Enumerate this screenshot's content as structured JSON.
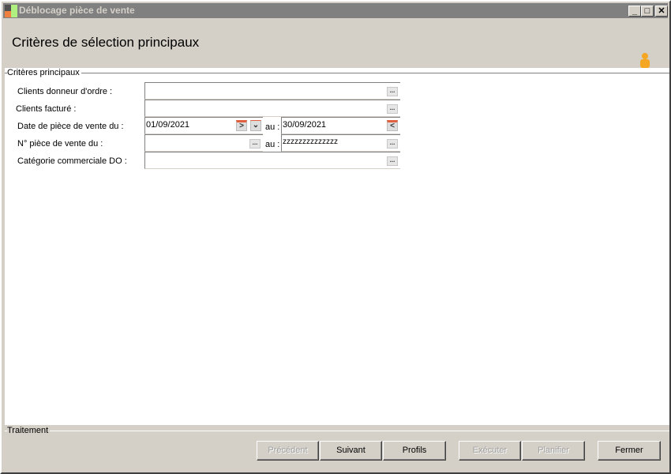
{
  "window": {
    "title": "Déblocage pièce de vente",
    "controls": [
      "minimize",
      "maximize",
      "close"
    ]
  },
  "header": {
    "title": "Critères de sélection principaux",
    "icon": "user-icon"
  },
  "criteria": {
    "group_label": "Critères principaux",
    "fields": [
      {
        "label": "Clients donneur d'ordre :",
        "value": ""
      },
      {
        "label": "Clients facturé :",
        "value": ""
      },
      {
        "label": "Date de pièce de vente du :",
        "value_from": "01/09/2021",
        "to_label": "au :",
        "value_to": "30/09/2021"
      },
      {
        "label": "N° pièce de vente du :",
        "value_from": "",
        "to_label": "au :",
        "value_to": "zzzzzzzzzzzzzz"
      },
      {
        "label": "Catégorie commerciale DO :",
        "value": ""
      }
    ]
  },
  "footer": {
    "group_label": "Traitement",
    "buttons": [
      {
        "label": "Précédent",
        "enabled": false
      },
      {
        "label": "Suivant",
        "enabled": true
      },
      {
        "label": "Profils",
        "enabled": true
      },
      {
        "label": "Exécuter",
        "enabled": false
      },
      {
        "label": "Planifier",
        "enabled": false
      },
      {
        "label": "Fermer",
        "enabled": true
      }
    ]
  }
}
